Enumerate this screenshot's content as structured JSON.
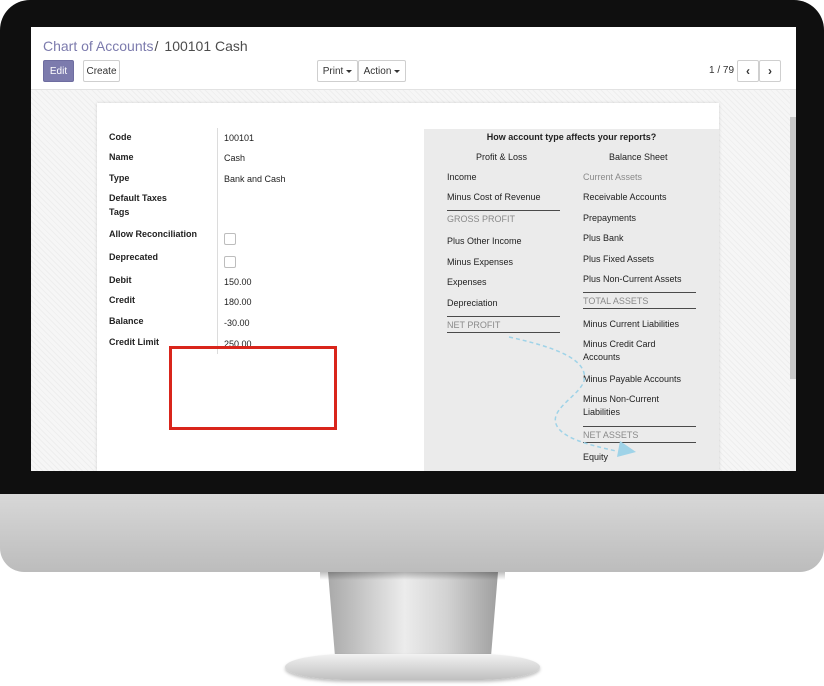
{
  "breadcrumb": {
    "parent": "Chart of Accounts",
    "separator": "/",
    "current": "100101 Cash"
  },
  "buttons": {
    "edit": "Edit",
    "create": "Create",
    "print": "Print",
    "action": "Action"
  },
  "pager": {
    "text": "1 / 79"
  },
  "fields": [
    {
      "label": "Code",
      "value": "100101"
    },
    {
      "label": "Name",
      "value": "Cash"
    },
    {
      "label": "Type",
      "value": "Bank and Cash"
    },
    {
      "label": "Default Taxes",
      "value": ""
    },
    {
      "label": "Tags",
      "value": ""
    },
    {
      "label": "Allow Reconciliation",
      "checked": false
    },
    {
      "label": "Deprecated",
      "checked": false
    },
    {
      "label": "Debit",
      "value": "150.00"
    },
    {
      "label": "Credit",
      "value": "180.00"
    },
    {
      "label": "Balance",
      "value": "-30.00"
    },
    {
      "label": "Credit Limit",
      "value": "250.00"
    }
  ],
  "help": {
    "title": "How account type affects your reports?",
    "pl_title": "Profit & Loss",
    "bs_title": "Balance Sheet",
    "pl_items": [
      "Income",
      "Minus Cost of Revenue",
      "GROSS PROFIT",
      "Plus Other Income",
      "Minus Expenses",
      "Expenses",
      "Depreciation",
      "NET PROFIT"
    ],
    "bs_items": [
      "Current Assets",
      "Receivable Accounts",
      "Prepayments",
      "Plus Bank",
      "Plus Fixed Assets",
      "Plus Non-Current Assets",
      "TOTAL ASSETS",
      "Minus Current Liabilities",
      "Minus Credit Card Accounts",
      "Minus Payable Accounts",
      "Minus Non-Current Liabilities",
      "NET ASSETS",
      "Equity"
    ]
  },
  "colors": {
    "accent": "#7c7bad",
    "highlight": "#d9251b",
    "arrow": "#9fd3e8"
  },
  "icons": {
    "prev": "chevron-left-icon",
    "next": "chevron-right-icon"
  }
}
